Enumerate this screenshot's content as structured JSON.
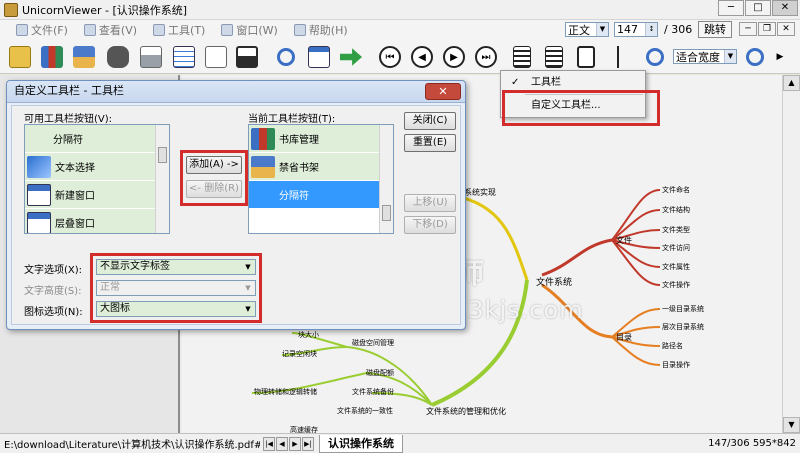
{
  "window": {
    "title": "UnicornViewer - [认识操作系统]",
    "buttons": [
      "─",
      "□",
      "✕"
    ]
  },
  "menubar": {
    "items": [
      "文件(F)",
      "查看(V)",
      "工具(T)",
      "窗口(W)",
      "帮助(H)"
    ],
    "view_mode": "正文",
    "page_current": "147",
    "page_total": "/ 306",
    "jump_label": "跳转"
  },
  "toolbar": {
    "zoom_mode": "适合宽度"
  },
  "dialog": {
    "title": "自定义工具栏 - 工具栏",
    "close_x": "✕",
    "available_label": "可用工具栏按钮(V):",
    "current_label": "当前工具栏按钮(T):",
    "available_items": [
      "分隔符",
      "文本选择",
      "新建窗口",
      "层叠窗口"
    ],
    "current_items": [
      "书库管理",
      "禁省书架",
      "分隔符"
    ],
    "add_button": "添加(A) ->",
    "remove_button": "<- 删除(R)",
    "close_button": "关闭(C)",
    "reset_button": "重置(E)",
    "move_up_button": "上移(U)",
    "move_down_button": "下移(D)",
    "text_option_label": "文字选项(X):",
    "text_option_value": "不显示文字标签",
    "text_height_label": "文字高度(S):",
    "text_height_value": "正常",
    "icon_option_label": "图标选项(N):",
    "icon_option_value": "大图标"
  },
  "popup_menu": {
    "check_mark": "✓",
    "toolbar_item": "工具栏",
    "customize_item": "自定义工具栏..."
  },
  "mindmap": {
    "center": "文件系统",
    "branch_top": "文件系统实现",
    "branch_bottom": "文件系统的管理和优化",
    "file_label": "文件",
    "file_items": [
      "文件命名",
      "文件结构",
      "文件类型",
      "文件访问",
      "文件属性",
      "文件操作"
    ],
    "dir_label": "目录",
    "dir_items": [
      "一级目录系统",
      "层次目录系统",
      "路径名",
      "目录操作"
    ],
    "mgmt_items": [
      "磁盘空间管理",
      "磁盘配额",
      "文件系统备份",
      "文件系统的一致性"
    ],
    "left_items": [
      "块大小",
      "记录空闲块",
      "物理转储和逻辑转储"
    ],
    "bottom_cut": "高速缓存"
  },
  "watermark": {
    "brand": "科技师",
    "url": "https://www.3kjs.com"
  },
  "statusbar": {
    "path": "E:\\download\\Literature\\计算机技术\\认识操作系统.pdf#147",
    "nav": [
      "|◀",
      "◀",
      "▶",
      "▶|"
    ],
    "tab_name": "认识操作系统",
    "page_info": "147/306 595*842"
  }
}
